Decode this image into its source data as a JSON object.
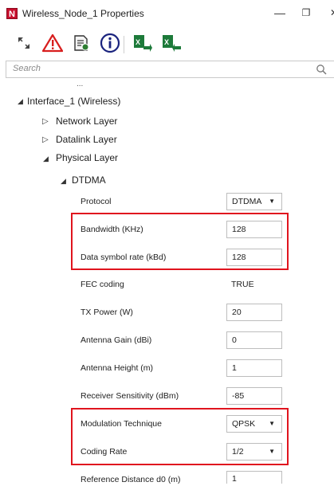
{
  "window": {
    "title": "Wireless_Node_1 Properties",
    "app_icon_letter": "N",
    "minimize_label": "—",
    "restore_label": "❐",
    "close_label": "✕"
  },
  "search": {
    "placeholder": "Search"
  },
  "tree": {
    "truncated_item": "...",
    "interface": "Interface_1 (Wireless)",
    "network_layer": "Network Layer",
    "datalink_layer": "Datalink Layer",
    "physical_layer": "Physical Layer",
    "dtdma": "DTDMA"
  },
  "properties": [
    {
      "label": "Protocol",
      "value": "DTDMA",
      "kind": "select"
    },
    {
      "label": "Bandwidth (KHz)",
      "value": "128",
      "kind": "input"
    },
    {
      "label": "Data symbol rate (kBd)",
      "value": "128",
      "kind": "input"
    },
    {
      "label": "FEC coding",
      "value": "TRUE",
      "kind": "static"
    },
    {
      "label": "TX Power (W)",
      "value": "20",
      "kind": "input"
    },
    {
      "label": "Antenna Gain (dBi)",
      "value": "0",
      "kind": "input"
    },
    {
      "label": "Antenna Height (m)",
      "value": "1",
      "kind": "input"
    },
    {
      "label": "Receiver Sensitivity (dBm)",
      "value": "-85",
      "kind": "input"
    },
    {
      "label": "Modulation Technique",
      "value": "QPSK",
      "kind": "select"
    },
    {
      "label": "Coding Rate",
      "value": "1/2",
      "kind": "select"
    },
    {
      "label": "Reference Distance d0 (m)",
      "value": "1",
      "kind": "input"
    }
  ],
  "colors": {
    "highlight": "#e0141e",
    "app_icon": "#c8102e"
  }
}
